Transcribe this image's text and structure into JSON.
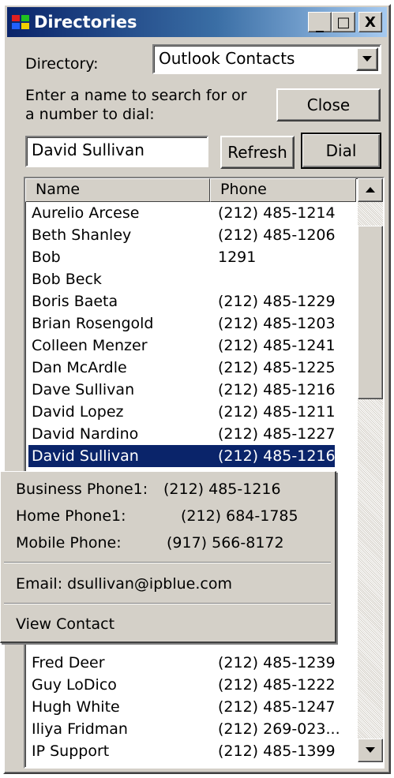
{
  "window": {
    "title": "Directories",
    "minimize": "_",
    "maximize": "□",
    "close": "X"
  },
  "directory": {
    "label": "Directory:",
    "value": "Outlook Contacts"
  },
  "search": {
    "instruction_line1": "Enter a name to search for or",
    "instruction_line2": "a number to dial:",
    "value": "David Sullivan"
  },
  "buttons": {
    "close": "Close",
    "refresh": "Refresh",
    "dial": "Dial"
  },
  "list": {
    "columns": [
      "Name",
      "Phone"
    ],
    "rows_top": [
      {
        "name": "Aurelio  Arcese",
        "phone": "(212) 485-1214"
      },
      {
        "name": "Beth  Shanley",
        "phone": "(212) 485-1206"
      },
      {
        "name": "Bob",
        "phone": "1291"
      },
      {
        "name": "Bob  Beck",
        "phone": ""
      },
      {
        "name": "Boris  Baeta",
        "phone": "(212) 485-1229"
      },
      {
        "name": "Brian  Rosengold",
        "phone": "(212) 485-1203"
      },
      {
        "name": "Colleen  Menzer",
        "phone": "(212) 485-1241"
      },
      {
        "name": "Dan  McArdle",
        "phone": "(212) 485-1225"
      },
      {
        "name": "Dave  Sullivan",
        "phone": "(212) 485-1216"
      },
      {
        "name": "David  Lopez",
        "phone": "(212) 485-1211"
      },
      {
        "name": "David  Nardino",
        "phone": "(212) 485-1227"
      }
    ],
    "selected": {
      "name": "David  Sullivan",
      "phone": "(212) 485-1216"
    },
    "rows_bottom": [
      {
        "name": "Fred  Deer",
        "phone": "(212) 485-1239"
      },
      {
        "name": "Guy  LoDico",
        "phone": "(212) 485-1222"
      },
      {
        "name": "Hugh  White",
        "phone": "(212) 485-1247"
      },
      {
        "name": "Iliya  Fridman",
        "phone": "(212) 269-023..."
      },
      {
        "name": "IP  Support",
        "phone": "(212) 485-1399"
      }
    ]
  },
  "popup": {
    "business_label": "Business Phone1:",
    "business_value": "(212) 485-1216",
    "home_label": "Home Phone1:",
    "home_value": "(212) 684-1785",
    "mobile_label": "Mobile Phone:",
    "mobile_value": "(917) 566-8172",
    "email": "Email: dsullivan@ipblue.com",
    "view_contact": "View Contact"
  }
}
